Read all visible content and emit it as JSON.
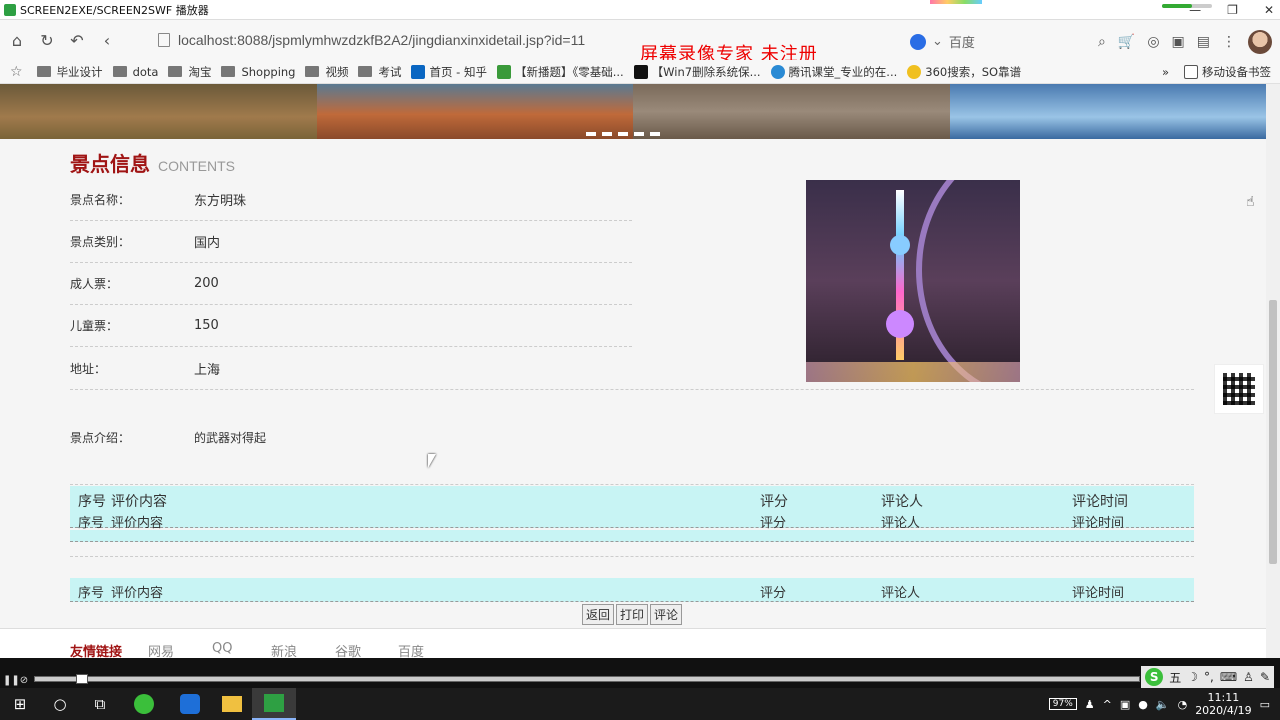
{
  "player": {
    "title": "SCREEN2EXE/SCREEN2SWF 播放器",
    "minimize": "—",
    "restore": "❐",
    "close": "✕"
  },
  "browser": {
    "url": "localhost:8088/jspmlymhwzdzkfB2A2/jingdianxinxidetail.jsp?id=11",
    "watermark": "屏幕录像专家 未注册",
    "search_engine": "百度",
    "bookmarks": [
      "毕业设计",
      "dota",
      "淘宝",
      "Shopping",
      "视频",
      "考试",
      "首页 - 知乎",
      "【新播题】《零基础...",
      "【Win7删除系统保...",
      "腾讯课堂_专业的在...",
      "360搜索，SO靠谱"
    ],
    "bookmarks_more": "»",
    "mobile_bookmarks": "移动设备书签"
  },
  "page": {
    "section_title_cn": "景点信息",
    "section_title_en": "CONTENTS",
    "fields": [
      {
        "label": "景点名称：",
        "value": "东方明珠"
      },
      {
        "label": "景点类别：",
        "value": "国内"
      },
      {
        "label": "成人票：",
        "value": "200"
      },
      {
        "label": "儿童票：",
        "value": "150"
      },
      {
        "label": "地址：",
        "value": "上海"
      }
    ],
    "intro_label": "景点介绍：",
    "intro_value": "的武器对得起",
    "review_headers": {
      "no": "序号",
      "content": "评价内容",
      "score": "评分",
      "reviewer": "评论人",
      "time": "评论时间"
    },
    "buttons": {
      "back": "返回",
      "print": "打印",
      "comment": "评论"
    },
    "footer_links": [
      "友情链接",
      "网易",
      "QQ",
      "新浪",
      "谷歌",
      "百度"
    ]
  },
  "ime": {
    "logo": "S",
    "mode": "五"
  },
  "taskbar": {
    "battery": "97%",
    "time": "11:11",
    "date": "2020/4/19"
  }
}
